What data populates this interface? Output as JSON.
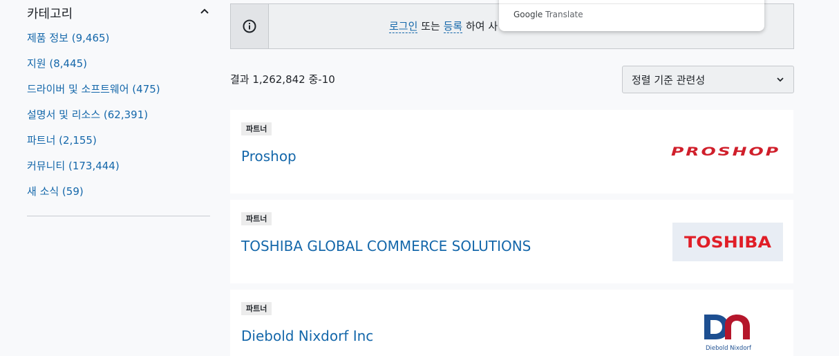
{
  "sidebar": {
    "title": "카테고리",
    "items": [
      {
        "label": "제품 정보 (9,465)"
      },
      {
        "label": "지원 (8,445)"
      },
      {
        "label": "드라이버 및 소프트웨어 (475)"
      },
      {
        "label": "설명서 및 리소스 (62,391)"
      },
      {
        "label": "파트너 (2,155)"
      },
      {
        "label": "커뮤니티 (173,444)"
      },
      {
        "label": "새 소식 (59)"
      }
    ]
  },
  "banner": {
    "icon": "info-icon",
    "login_link": "로그인",
    "or_text": "또는",
    "register_link": "등록",
    "suffix": "하여 사"
  },
  "translate_popup": {
    "google": "Google",
    "translate": "Translate"
  },
  "results": {
    "count_text": "결과 1,262,842 중-10",
    "sort_label": "정렬 기준 관련성"
  },
  "cards": [
    {
      "tag": "파트너",
      "title": "Proshop",
      "logo_text": "PROSHOP",
      "logo_color": "#d01f2b"
    },
    {
      "tag": "파트너",
      "title": "TOSHIBA GLOBAL COMMERCE SOLUTIONS",
      "logo_text": "TOSHIBA",
      "logo_color": "#e01e27"
    },
    {
      "tag": "파트너",
      "title": "Diebold Nixdorf Inc",
      "logo_caption": "Diebold Nixdorf"
    }
  ],
  "colors": {
    "link": "#1467aa",
    "diebold_blue": "#1d4f91",
    "diebold_red": "#b5162b"
  }
}
